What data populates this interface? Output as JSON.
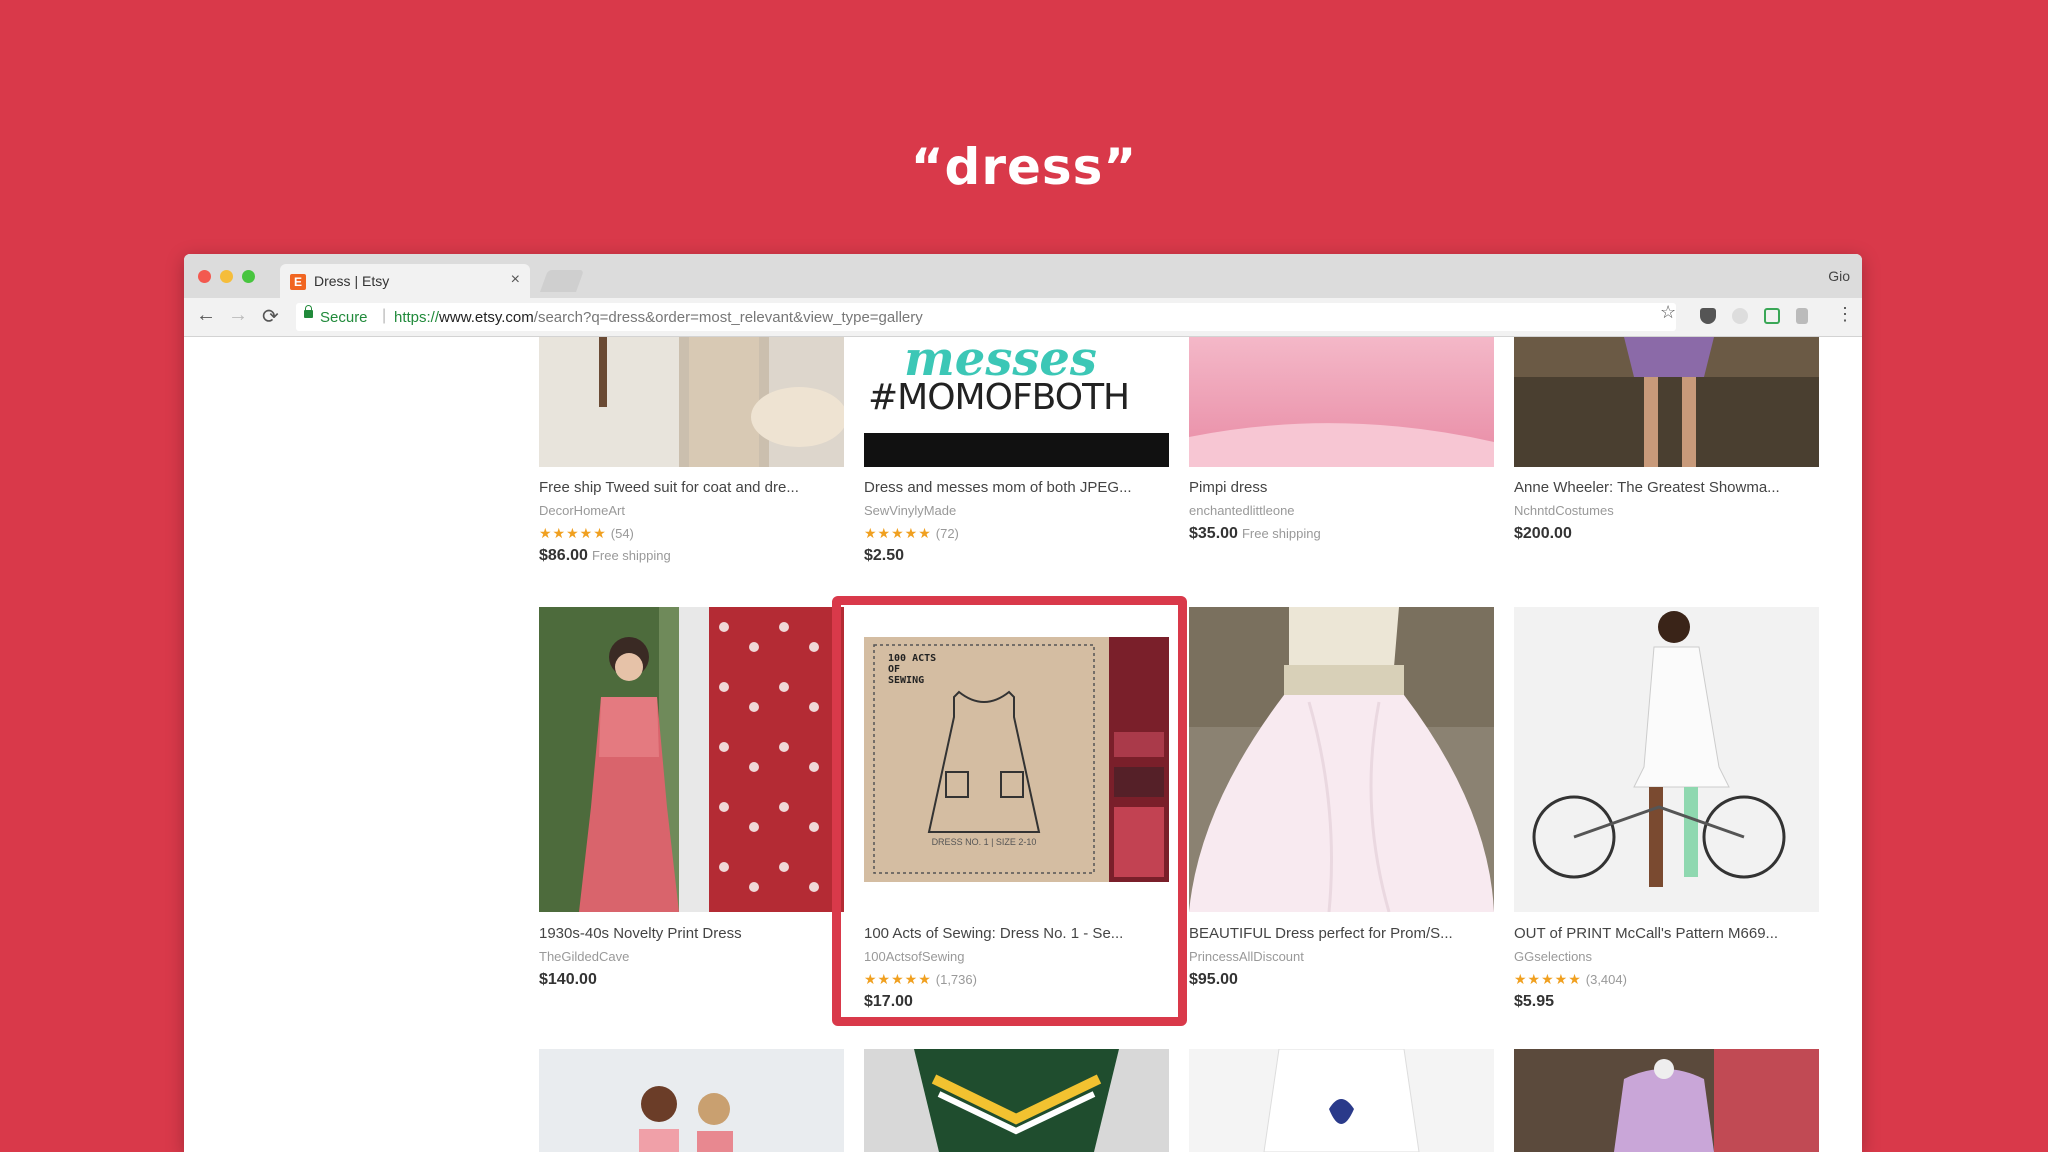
{
  "slide": {
    "title": "“dress”"
  },
  "browser": {
    "tab": {
      "favicon": "E",
      "title": "Dress | Etsy",
      "close": "×"
    },
    "profile": "Gio",
    "secure_label": "Secure",
    "url": {
      "scheme": "https://",
      "domain": "www.etsy.com",
      "path": "/search?q=dress&order=most_relevant&view_type=gallery"
    },
    "icons": [
      "back-icon",
      "forward-icon",
      "reload-icon",
      "lock-icon",
      "bookmark-star-icon",
      "pocket-icon",
      "extension-icon",
      "menu-icon"
    ]
  },
  "results": {
    "row1": [
      {
        "title": "Free ship Tweed suit for coat and dre...",
        "shop": "DecorHomeArt",
        "stars": "★★★★★",
        "count": "(54)",
        "price": "$86.00",
        "shipping": "Free shipping"
      },
      {
        "title": "Dress and messes mom of both JPEG...",
        "shop": "SewVinylyMade",
        "stars": "★★★★★",
        "count": "(72)",
        "price": "$2.50",
        "shipping": "",
        "image_text_top": "messes",
        "image_text_bottom": "#MOMOFBOTH"
      },
      {
        "title": "Pimpi dress",
        "shop": "enchantedlittleone",
        "price": "$35.00",
        "shipping": "Free shipping"
      },
      {
        "title": "Anne Wheeler: The Greatest Showma...",
        "shop": "NchntdCostumes",
        "price": "$200.00"
      }
    ],
    "row2": [
      {
        "title": "1930s-40s Novelty Print Dress",
        "shop": "TheGildedCave",
        "price": "$140.00"
      },
      {
        "title": "100 Acts of Sewing: Dress No. 1 - Se...",
        "shop": "100ActsofSewing",
        "stars": "★★★★★",
        "count": "(1,736)",
        "price": "$17.00",
        "image_text": "100 ACTS OF SEWING",
        "image_caption": "DRESS NO. 1 | SIZE 2-10"
      },
      {
        "title": "BEAUTIFUL Dress perfect for Prom/S...",
        "shop": "PrincessAllDiscount",
        "price": "$95.00"
      },
      {
        "title": "OUT of PRINT McCall's Pattern M669...",
        "shop": "GGselections",
        "stars": "★★★★★",
        "count": "(3,404)",
        "price": "$5.95"
      }
    ]
  }
}
